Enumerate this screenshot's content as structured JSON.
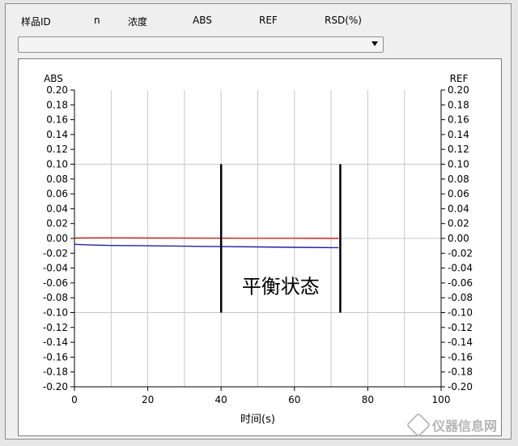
{
  "header": {
    "col_sample_id": "样品ID",
    "col_n": "n",
    "col_concentration": "浓度",
    "col_abs": "ABS",
    "col_ref": "REF",
    "col_rsd": "RSD(%)"
  },
  "dropdown": {
    "selected": ""
  },
  "annotation": {
    "label": "平衡状态"
  },
  "watermark": {
    "text": "仪器信息网"
  },
  "chart_data": {
    "type": "line",
    "xlabel": "时间(s)",
    "ylabel_left": "ABS",
    "ylabel_right": "REF",
    "xlim": [
      0,
      100
    ],
    "ylim": [
      -0.2,
      0.2
    ],
    "x_ticks": [
      "0",
      "20",
      "40",
      "60",
      "80",
      "100"
    ],
    "y_ticks": [
      "0.20",
      "0.18",
      "0.16",
      "0.14",
      "0.12",
      "0.10",
      "0.08",
      "0.06",
      "0.04",
      "0.02",
      "0.00",
      "-0.02",
      "-0.04",
      "-0.06",
      "-0.08",
      "-0.10",
      "-0.12",
      "-0.14",
      "-0.16",
      "-0.18",
      "-0.20"
    ],
    "grid": true,
    "series": [
      {
        "color": "#cc2222",
        "x": [
          0,
          10,
          20,
          30,
          40,
          50,
          60,
          72
        ],
        "y": [
          0.0005,
          0.0008,
          0.0006,
          0.0004,
          0.0003,
          0.0002,
          0.0002,
          0.0
        ]
      },
      {
        "color": "#2222aa",
        "x": [
          0,
          5,
          10,
          20,
          30,
          40,
          50,
          60,
          72
        ],
        "y": [
          -0.008,
          -0.009,
          -0.0095,
          -0.01,
          -0.0105,
          -0.011,
          -0.0115,
          -0.012,
          -0.0125
        ]
      }
    ],
    "markers": [
      {
        "x": 40,
        "y_from": 0.1,
        "y_to": -0.1
      },
      {
        "x": 72.5,
        "y_from": 0.1,
        "y_to": -0.1
      }
    ]
  }
}
